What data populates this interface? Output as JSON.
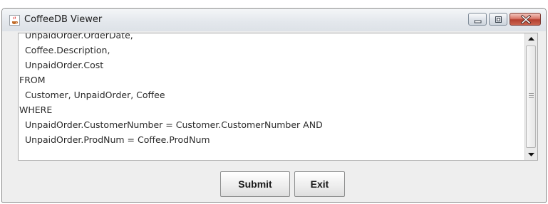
{
  "window": {
    "title": "CoffeeDB Viewer"
  },
  "query_text": {
    "lines": [
      "  UnpaidOrder.OrderDate,",
      "  Coffee.Description,",
      "  UnpaidOrder.Cost",
      "FROM",
      "  Customer, UnpaidOrder, Coffee",
      "WHERE",
      "  UnpaidOrder.CustomerNumber = Customer.CustomerNumber AND",
      "  UnpaidOrder.ProdNum = Coffee.ProdNum"
    ]
  },
  "buttons": {
    "submit_label": "Submit",
    "exit_label": "Exit"
  },
  "icons": {
    "app": "java-cup-icon",
    "minimize": "minimize-icon",
    "maximize": "maximize-icon",
    "close": "close-icon",
    "scroll_up": "arrow-up-icon",
    "scroll_down": "arrow-down-icon"
  },
  "colors": {
    "close_button": "#c9634f",
    "window_frame": "#dfe3e8",
    "content_background": "#eeeeee"
  }
}
